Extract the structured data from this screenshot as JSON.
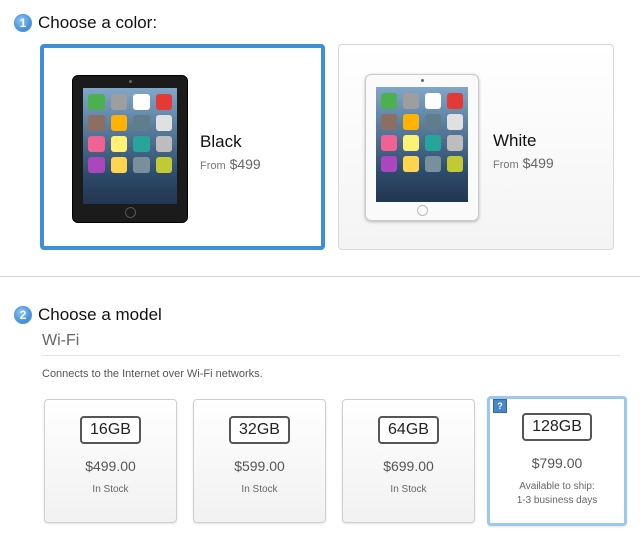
{
  "step1": {
    "number": "1",
    "title": "Choose a color:"
  },
  "colors": [
    {
      "name": "Black",
      "from_label": "From",
      "price": "$499",
      "selected": true
    },
    {
      "name": "White",
      "from_label": "From",
      "price": "$499",
      "selected": false
    }
  ],
  "step2": {
    "number": "2",
    "title": "Choose a model",
    "subheading": "Wi-Fi",
    "description": "Connects to the Internet over Wi-Fi networks."
  },
  "models": [
    {
      "capacity": "16GB",
      "price": "$499.00",
      "status": "In Stock",
      "selected": false
    },
    {
      "capacity": "32GB",
      "price": "$599.00",
      "status": "In Stock",
      "selected": false
    },
    {
      "capacity": "64GB",
      "price": "$699.00",
      "status": "In Stock",
      "selected": false
    },
    {
      "capacity": "128GB",
      "price": "$799.00",
      "status_line1": "Available to ship:",
      "status_line2": "1-3 business days",
      "help_badge": "?",
      "selected": true
    }
  ],
  "accent_color": "#3d8fd8",
  "icon_names": [
    "ipad-black-image",
    "ipad-white-image",
    "help-icon"
  ]
}
